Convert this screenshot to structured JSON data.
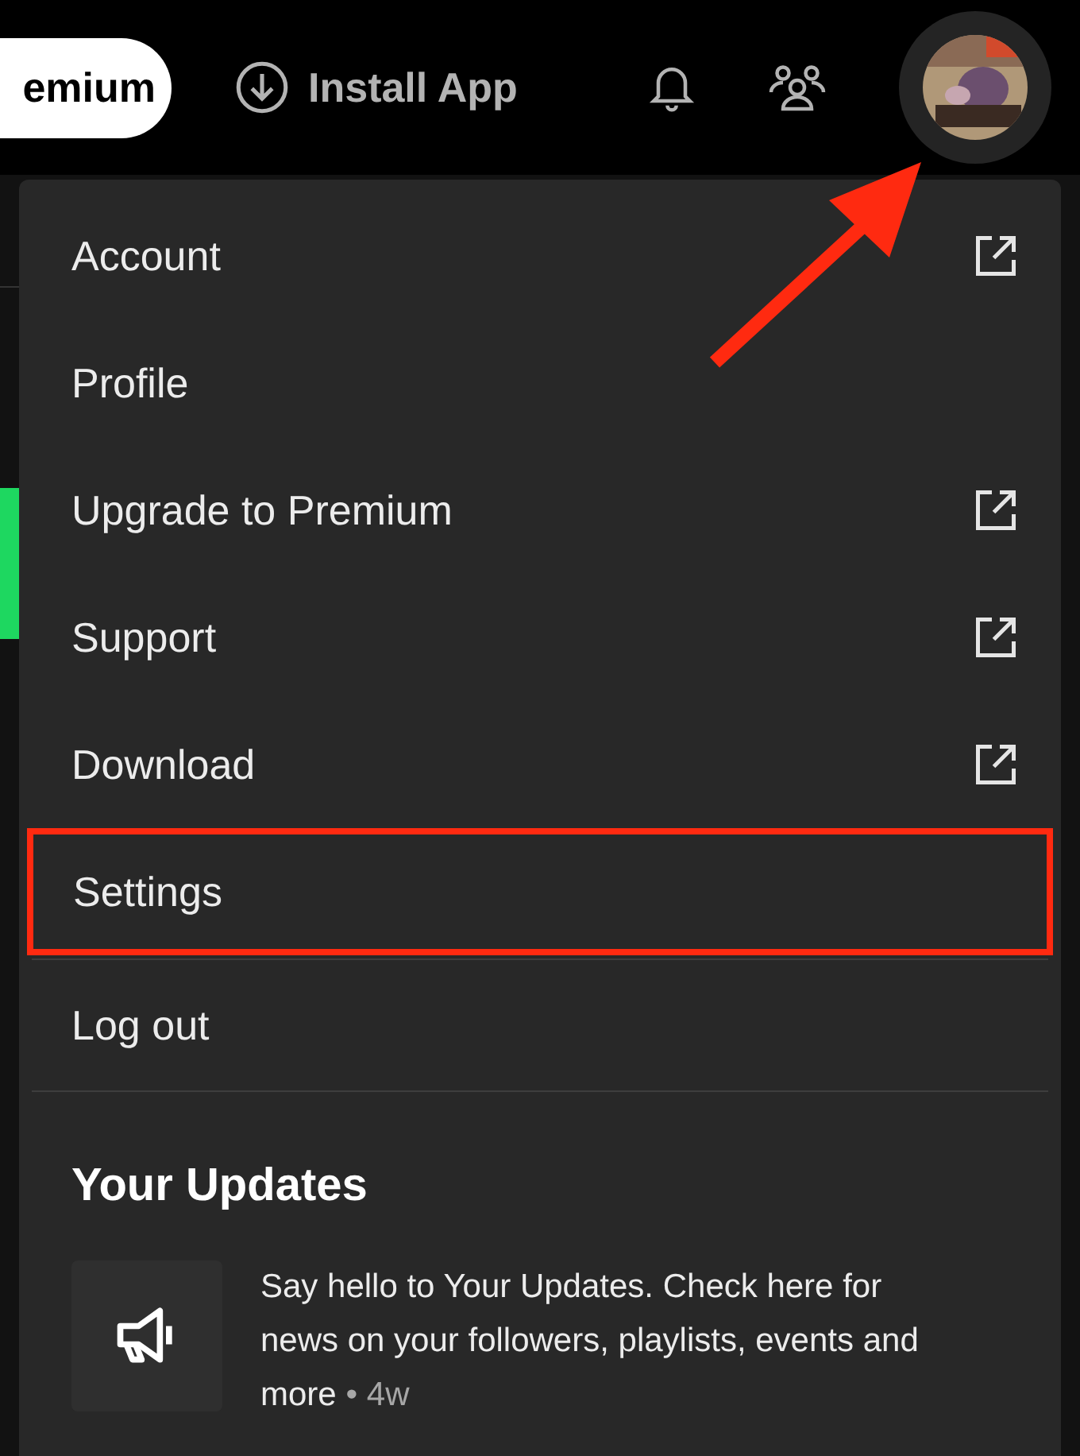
{
  "top_bar": {
    "premium_button": "emium",
    "install_button": "Install App"
  },
  "menu": {
    "items": [
      {
        "label": "Account",
        "external": true,
        "highlighted": false
      },
      {
        "label": "Profile",
        "external": false,
        "highlighted": false
      },
      {
        "label": "Upgrade to Premium",
        "external": true,
        "highlighted": false
      },
      {
        "label": "Support",
        "external": true,
        "highlighted": false
      },
      {
        "label": "Download",
        "external": true,
        "highlighted": false
      },
      {
        "label": "Settings",
        "external": false,
        "highlighted": true
      }
    ],
    "logout": "Log out",
    "updates": {
      "title": "Your Updates",
      "items": [
        {
          "text": "Say hello to Your Updates. Check here for news on your followers, playlists, events and more",
          "separator": "•",
          "time": "4w"
        }
      ]
    }
  }
}
